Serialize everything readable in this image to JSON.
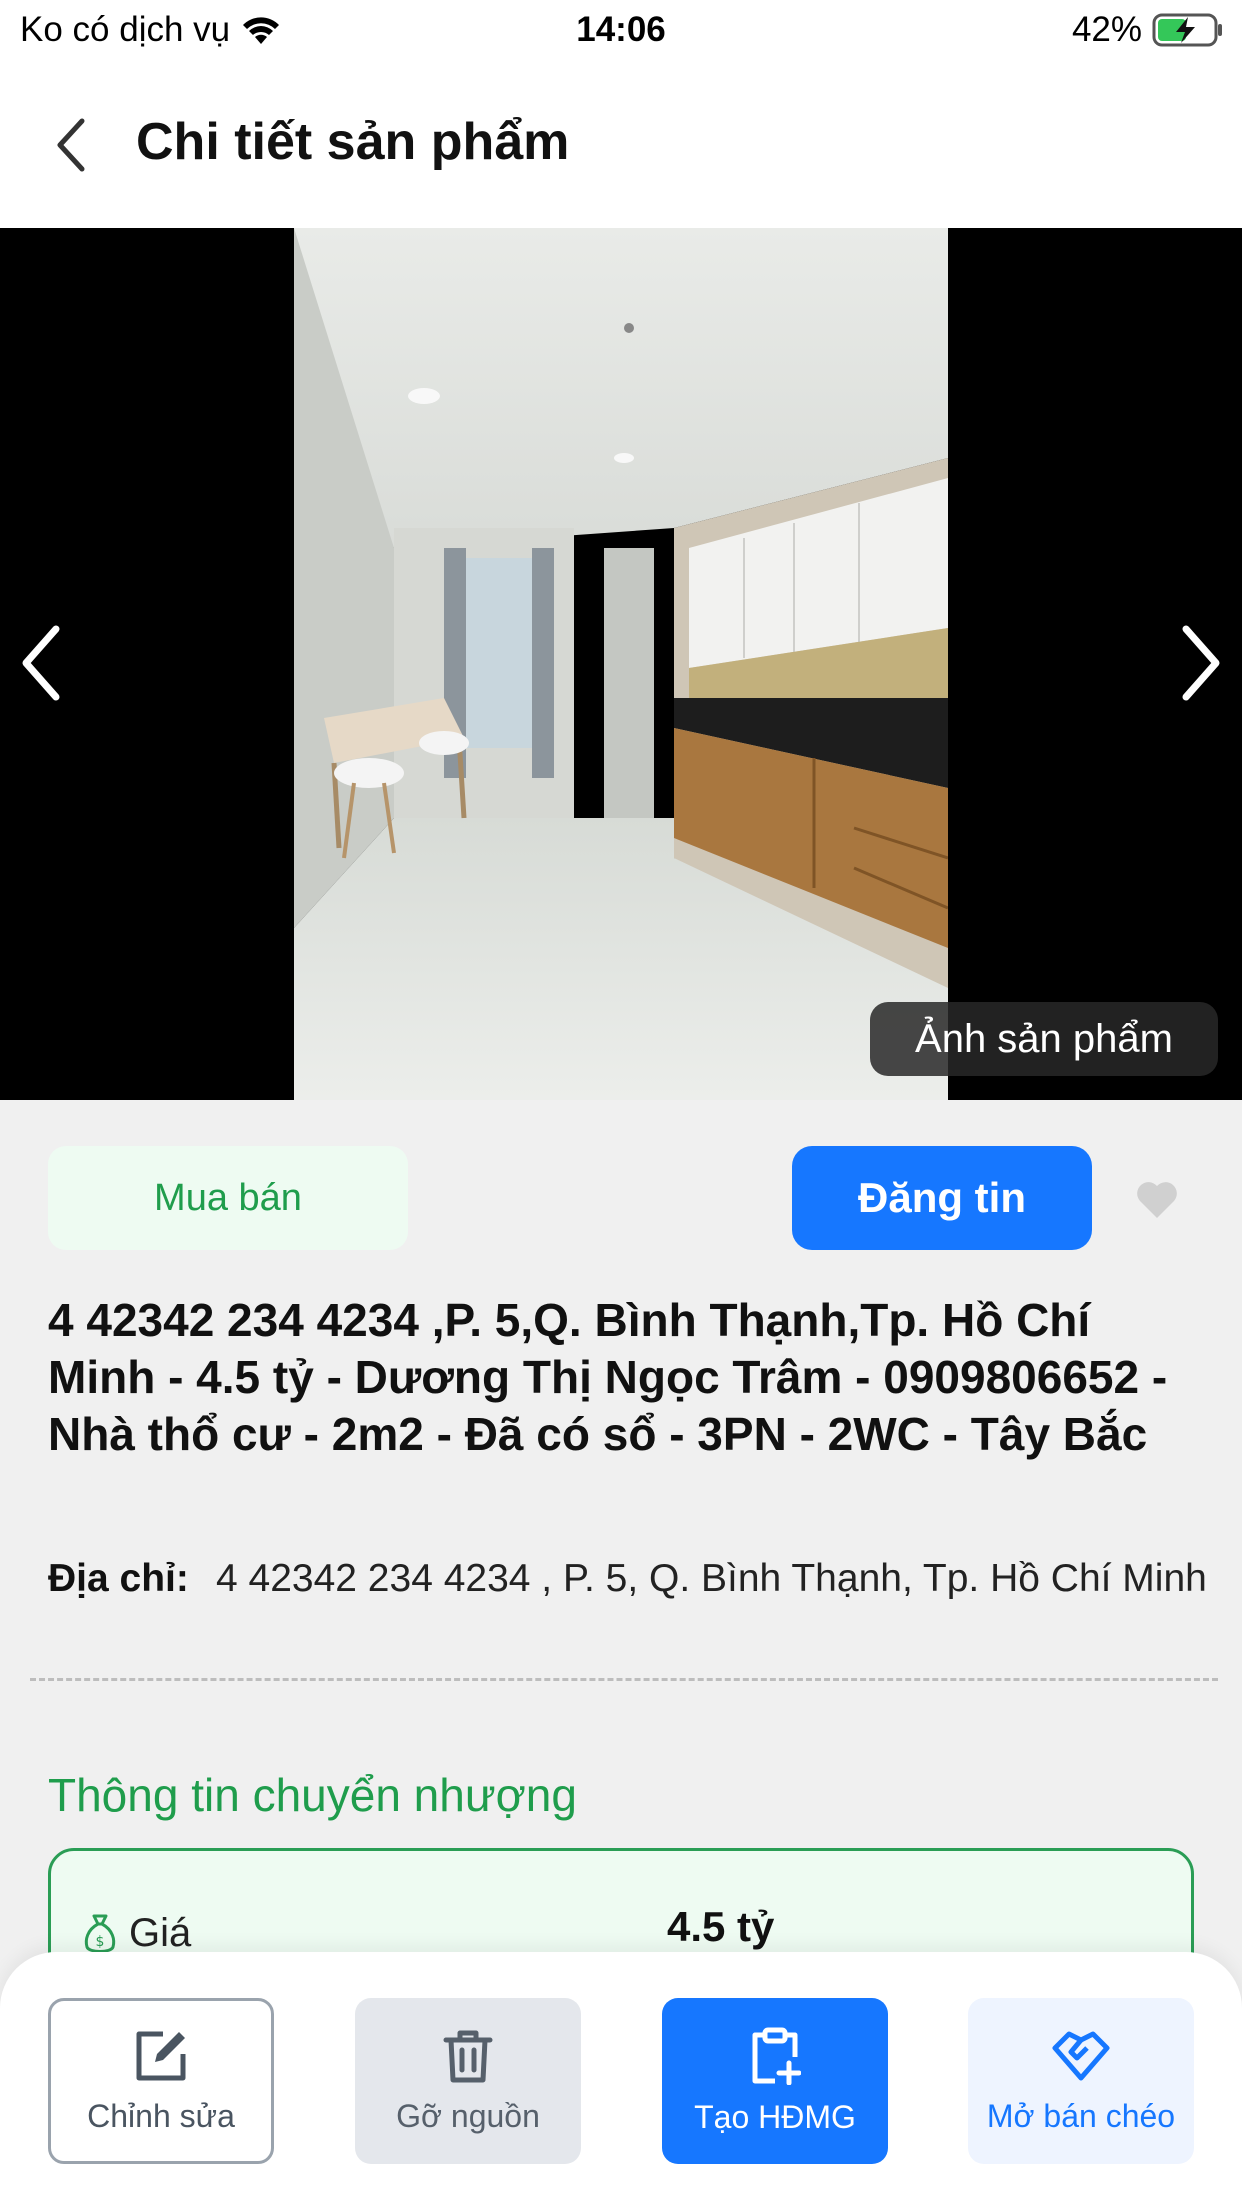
{
  "status_bar": {
    "carrier": "Ko có dịch vụ",
    "time": "14:06",
    "battery": "42%"
  },
  "header": {
    "title": "Chi tiết sản phẩm"
  },
  "gallery": {
    "label": "Ảnh sản phẩm"
  },
  "product": {
    "category": "Mua bán",
    "post_button": "Đăng tin",
    "title": "4 42342 234 4234 ,P. 5,Q. Bình Thạnh,Tp. Hồ Chí Minh - 4.5 tỷ - Dương Thị Ngọc Trâm - 0909806652 - Nhà thổ cư - 2m2 - Đã có sổ - 3PN - 2WC - Tây Bắc",
    "address_label": "Địa chỉ:",
    "address": "4 42342 234 4234 , P. 5, Q. Bình Thạnh, Tp. Hồ Chí Minh"
  },
  "transfer_info": {
    "section_title": "Thông tin chuyển nhượng",
    "price_label": "Giá",
    "price_value": "4.5 tỷ"
  },
  "actions": {
    "edit": "Chỉnh sửa",
    "remove": "Gỡ nguồn",
    "create": "Tạo HĐMG",
    "cross_sell": "Mở bán chéo"
  },
  "colors": {
    "primary": "#1677ff",
    "green": "#1f9d4c",
    "green_bg": "#eefbf2"
  }
}
